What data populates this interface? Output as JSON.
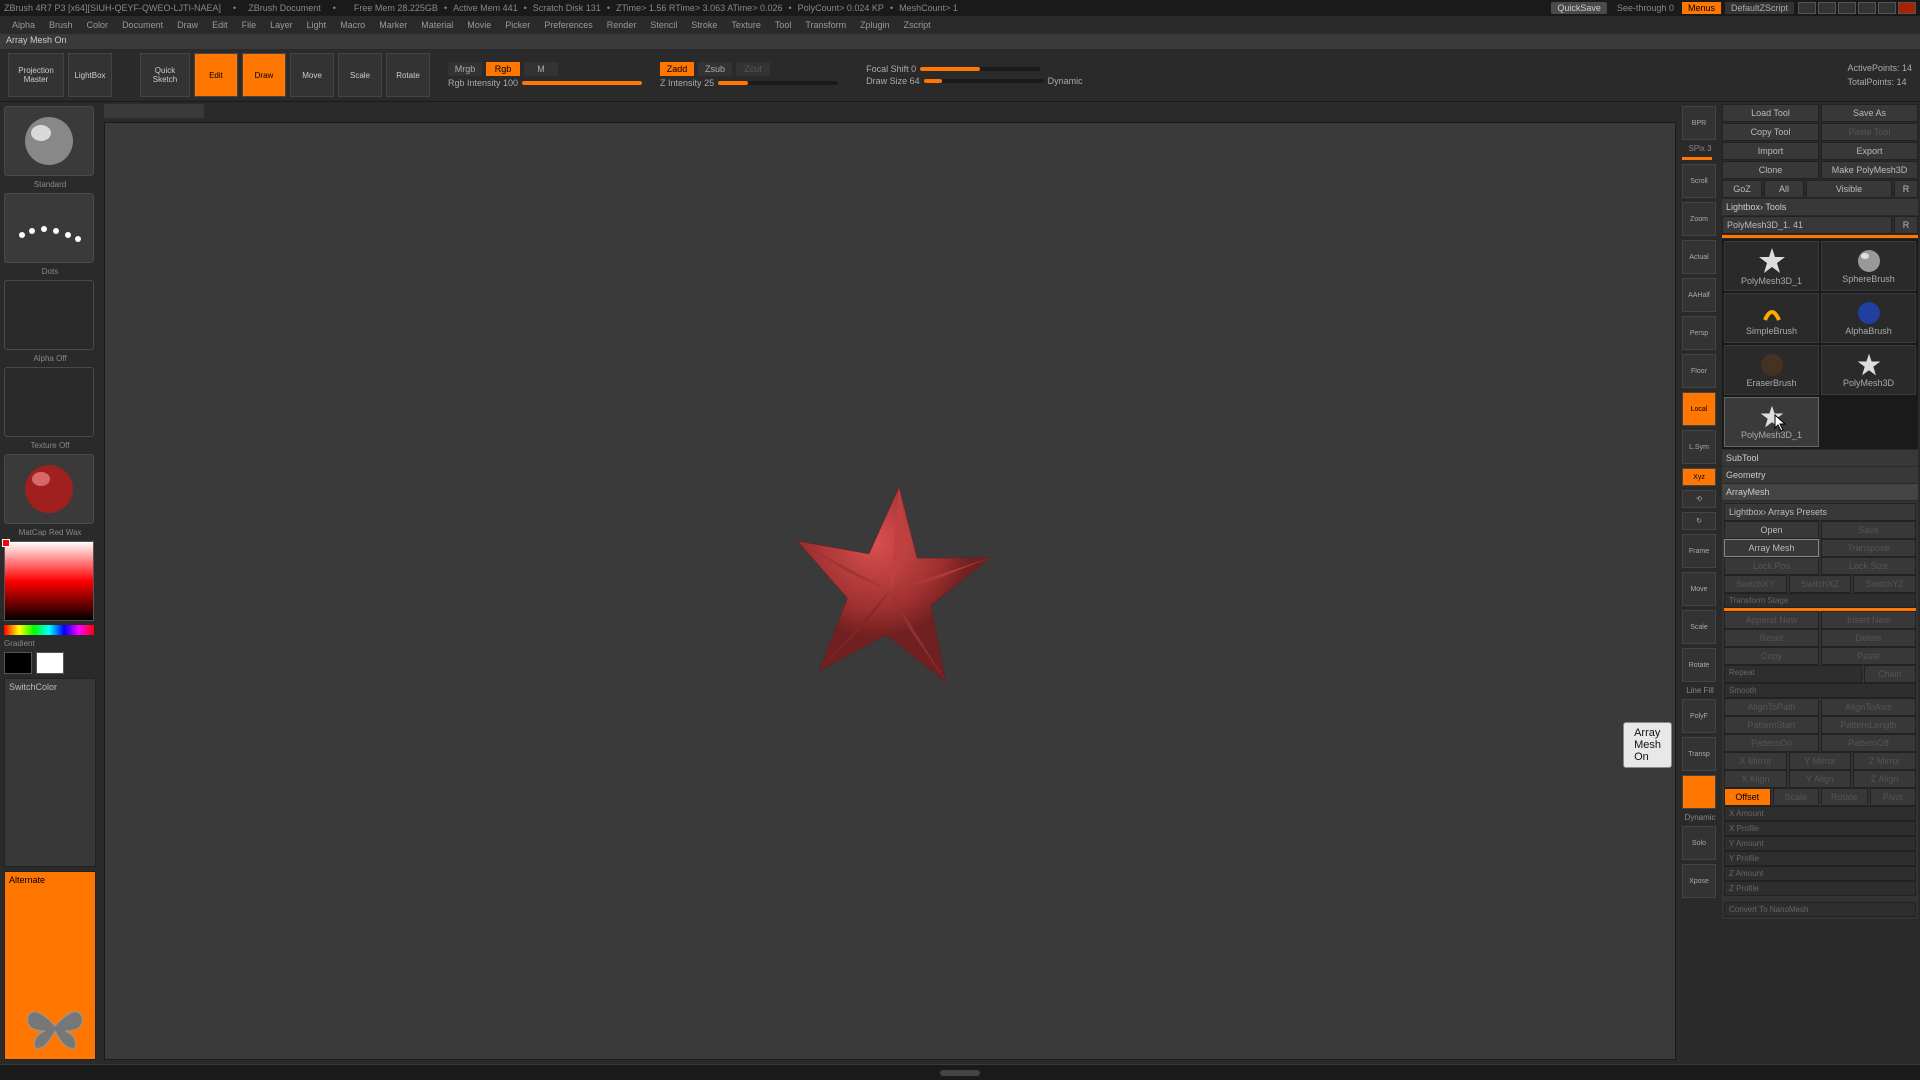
{
  "title": {
    "app": "ZBrush 4R7 P3 [x64][SIUH-QEYF-QWEO-LJTI-NAEA]",
    "doc": "ZBrush Document",
    "stats": [
      "Free Mem 28.225GB",
      "Active Mem 441",
      "Scratch Disk 131",
      "ZTime> 1.56 RTime> 3.063 ATime> 0.026",
      "PolyCount> 0.024 KP",
      "MeshCount> 1"
    ],
    "quicksave": "QuickSave",
    "seethrough": "See-through 0",
    "menus": "Menus",
    "defaultscript": "DefaultZScript"
  },
  "menus": [
    "Alpha",
    "Brush",
    "Color",
    "Document",
    "Draw",
    "Edit",
    "File",
    "Layer",
    "Light",
    "Macro",
    "Marker",
    "Material",
    "Movie",
    "Picker",
    "Preferences",
    "Render",
    "Stencil",
    "Stroke",
    "Texture",
    "Tool",
    "Transform",
    "Zplugin",
    "Zscript"
  ],
  "status": "Array Mesh On",
  "shelf": {
    "projection": "Projection\nMaster",
    "lightbox": "LightBox",
    "quicksketch": "Quick\nSketch",
    "edit": "Edit",
    "draw": "Draw",
    "move": "Move",
    "scale": "Scale",
    "rotate": "Rotate",
    "mrgb": "Mrgb",
    "rgb": "Rgb",
    "m": "M",
    "rgbInt": "Rgb Intensity 100",
    "zadd": "Zadd",
    "zsub": "Zsub",
    "zcut": "Zcut",
    "zInt": "Z Intensity 25",
    "focal": "Focal Shift 0",
    "drawsize": "Draw Size 64",
    "dynamic": "Dynamic",
    "activePts": "ActivePoints: 14",
    "totalPts": "TotalPoints: 14"
  },
  "left": {
    "standard": "Standard",
    "dots": "Dots",
    "alpha": "Alpha Off",
    "texture": "Texture Off",
    "matcap": "MatCap Red Wax",
    "gradient": "Gradient",
    "switchColor": "SwitchColor",
    "alternate": "Alternate"
  },
  "rightTools": [
    "BPR",
    "SPix 3",
    "Scroll",
    "Zoom",
    "Actual",
    "AAHalf",
    "Persp",
    "Floor",
    "Local",
    "L.Sym",
    "Xyz",
    "",
    "",
    "Frame",
    "Move",
    "Scale",
    "Rotate",
    "Line Fill",
    "PolyF",
    "",
    "Transp",
    "",
    "Dynamic",
    "Solo",
    "",
    "Xpose"
  ],
  "tooltip": "Array Mesh On",
  "panel": {
    "loadTool": "Load Tool",
    "saveAs": "Save As",
    "copyTool": "Copy Tool",
    "pasteTool": "Paste Tool",
    "import": "Import",
    "export": "Export",
    "clone": "Clone",
    "makepoly": "Make PolyMesh3D",
    "goz": "GoZ",
    "all": "All",
    "visible": "Visible",
    "r": "R",
    "lightboxTools": "Lightbox› Tools",
    "toolname": "PolyMesh3D_1. 41",
    "tools": [
      "PolyMesh3D_1",
      "SphereBrush",
      "AlphaBrush",
      "SimpleBrush",
      "EraserBrush",
      "PolyMesh3D",
      "PolyMesh3D_1"
    ],
    "subtool": "SubTool",
    "geometry": "Geometry",
    "arraymesh": "ArrayMesh",
    "lightboxArrays": "Lightbox› Arrays Presets",
    "open": "Open",
    "save": "Save",
    "arrayMeshBtn": "Array Mesh",
    "transpose": "Transpose",
    "lockPos": "Lock Pos",
    "lockSize": "Lock Size",
    "switchxy": "SwitchXY",
    "switchxz": "SwitchXZ",
    "switchyz": "SwitchYZ",
    "transformStage": "Transform Stage",
    "appendNew": "Append New",
    "insertNew": "Insert New",
    "reset": "Reset",
    "delete": "Delete",
    "copy": "Copy",
    "paste": "Paste",
    "repeat": "Repeat",
    "chain": "Chain",
    "smooth": "Smooth",
    "alignPath": "AlignToPath",
    "alignAxis": "AlignToAxis",
    "patStart": "PatternStart",
    "patLen": "PatternLength",
    "patOn": "PatternOn",
    "patOff": "PatternOff",
    "xmirror": "X Mirror",
    "ymirror": "Y Mirror",
    "zmirror": "Z Mirror",
    "xalign": "X Align",
    "yalign": "Y Align",
    "zalign": "Z Align",
    "offset": "Offset",
    "scale": "Scale",
    "rotate": "Rotate",
    "pivot": "Pivot",
    "xamt": "X Amount",
    "xprof": "X Profile",
    "yamt": "Y Amount",
    "yprof": "Y Profile",
    "zamt": "Z Amount",
    "zprof": "Z Profile",
    "convert": "Convert To NanoMesh"
  }
}
